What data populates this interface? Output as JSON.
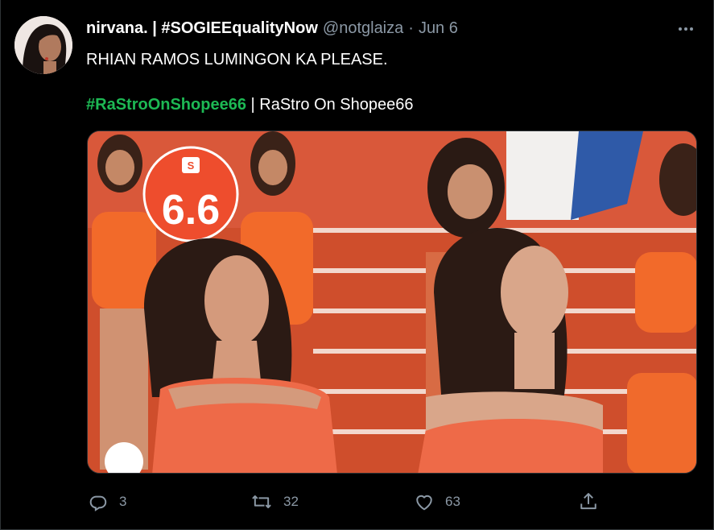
{
  "tweet": {
    "display_name": "nirvana. | #SOGIEEqualityNow",
    "handle": "@notglaiza",
    "separator": "·",
    "date": "Jun 6",
    "text_line1": "RHIAN RAMOS LUMINGON KA PLEASE.",
    "hashtag": "#RaStroOnShopee66",
    "text_after_hashtag": " | RaStro On Shopee66",
    "media_badge": "6.6"
  },
  "actions": {
    "reply_count": "3",
    "retweet_count": "32",
    "like_count": "63"
  },
  "colors": {
    "background": "#000000",
    "muted_text": "#8b98a5",
    "hashtag": "#1db954",
    "shopee_orange": "#ee4d2d",
    "stage_red": "#d2502c"
  },
  "icons": {
    "more": "more-dots-icon",
    "reply": "reply-bubble-icon",
    "retweet": "retweet-icon",
    "like": "heart-icon",
    "share": "share-upload-icon"
  }
}
